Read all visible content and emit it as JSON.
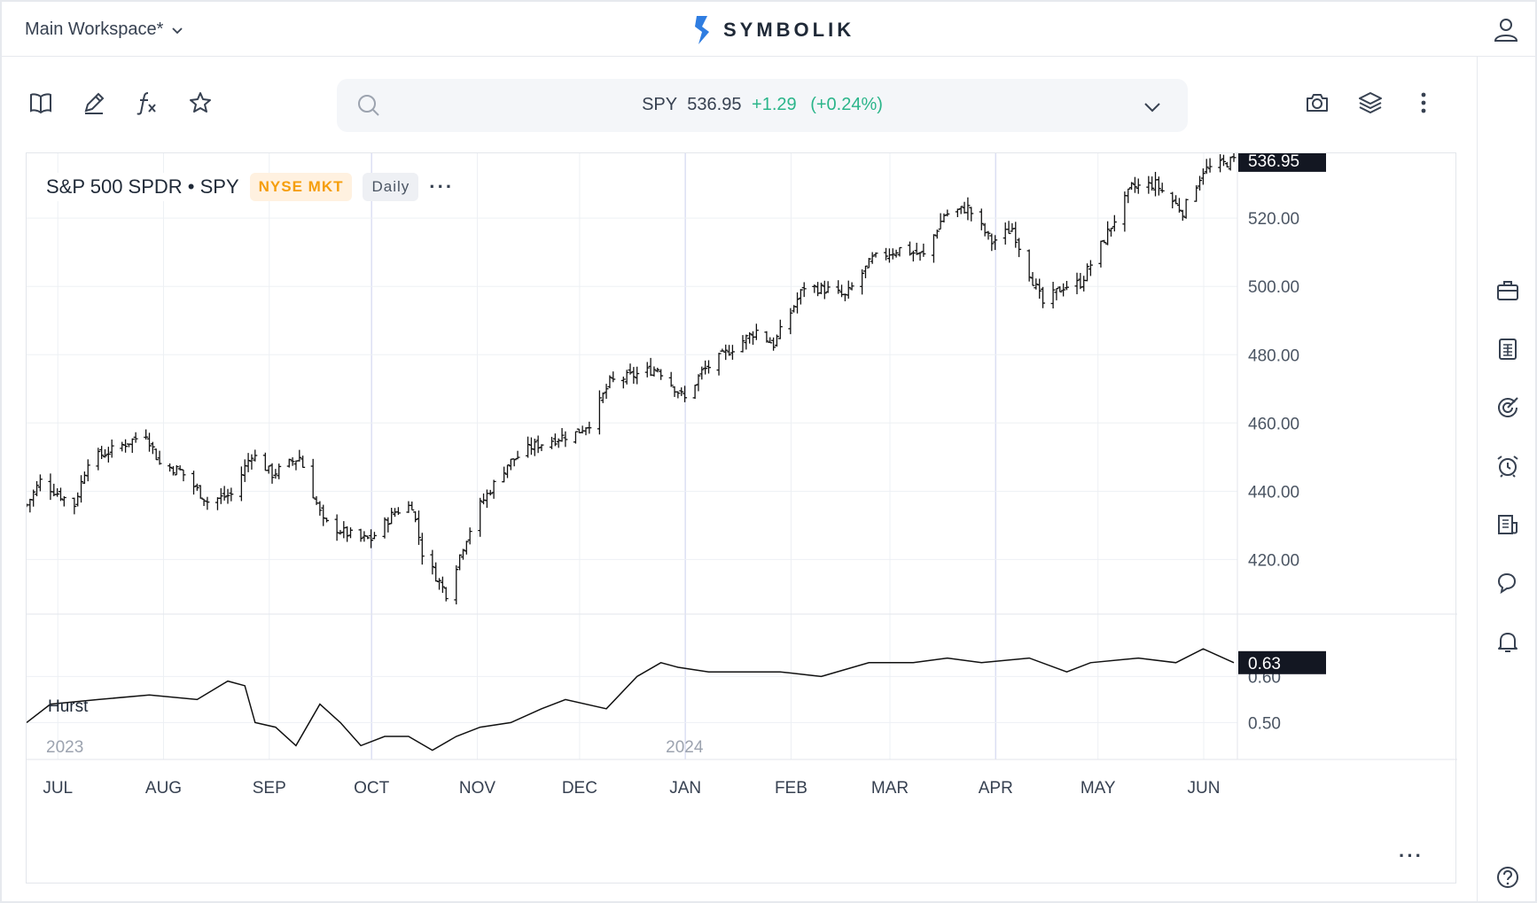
{
  "workspace": {
    "label": "Main Workspace*"
  },
  "brand": {
    "name": "SYMBOLIK"
  },
  "quote": {
    "symbol": "SPY",
    "price": "536.95",
    "change": "+1.29",
    "change_pct": "(+0.24%)"
  },
  "legend": {
    "title": "S&P 500 SPDR • SPY",
    "exchange": "NYSE MKT",
    "interval": "Daily",
    "more": "···"
  },
  "indicator": {
    "name": "Hurst"
  },
  "axis_more": "···",
  "colors": {
    "up": "#2bb58a",
    "exchange": "#f59e0b",
    "price_tag_bg": "#131722",
    "grid": "#edf0f4"
  },
  "toolbar": {
    "left_icons": [
      "book-icon",
      "pencil-icon",
      "function-icon",
      "star-icon"
    ],
    "right_icons": [
      "camera-icon",
      "layers-icon",
      "more-vertical-icon"
    ]
  },
  "rail": {
    "icons": [
      "briefcase-icon",
      "calculator-icon",
      "target-icon",
      "alarm-clock-icon",
      "report-icon",
      "chat-icon",
      "bell-icon",
      "help-icon"
    ]
  },
  "chart_data": [
    {
      "type": "ohlc",
      "title": "S&P 500 SPDR • SPY",
      "interval": "Daily",
      "ylim": [
        404,
        539
      ],
      "y_ticks": [
        "420.00",
        "440.00",
        "460.00",
        "480.00",
        "500.00",
        "520.00"
      ],
      "last_price_tag": "536.95",
      "x_ticks": [
        "JUL",
        "AUG",
        "SEP",
        "OCT",
        "NOV",
        "DEC",
        "JAN",
        "FEB",
        "MAR",
        "APR",
        "MAY",
        "JUN"
      ],
      "year_labels": [
        "2023",
        "2024"
      ],
      "x_range": [
        "2023-06-26",
        "2024-06-14"
      ],
      "close_series": [
        [
          "2023-06-26",
          436
        ],
        [
          "2023-06-30",
          443
        ],
        [
          "2023-07-07",
          438
        ],
        [
          "2023-07-10",
          436
        ],
        [
          "2023-07-14",
          449
        ],
        [
          "2023-07-21",
          452
        ],
        [
          "2023-07-31",
          457
        ],
        [
          "2023-08-04",
          448
        ],
        [
          "2023-08-10",
          446
        ],
        [
          "2023-08-18",
          437
        ],
        [
          "2023-08-25",
          439
        ],
        [
          "2023-08-31",
          451
        ],
        [
          "2023-09-06",
          445
        ],
        [
          "2023-09-14",
          450
        ],
        [
          "2023-09-21",
          431
        ],
        [
          "2023-09-27",
          428
        ],
        [
          "2023-10-02",
          426
        ],
        [
          "2023-10-05",
          426
        ],
        [
          "2023-10-12",
          434
        ],
        [
          "2023-10-17",
          436
        ],
        [
          "2023-10-20",
          422
        ],
        [
          "2023-10-27",
          410
        ],
        [
          "2023-11-01",
          424
        ],
        [
          "2023-11-06",
          436
        ],
        [
          "2023-11-14",
          448
        ],
        [
          "2023-11-21",
          453
        ],
        [
          "2023-11-30",
          456
        ],
        [
          "2023-12-04",
          457
        ],
        [
          "2023-12-08",
          460
        ],
        [
          "2023-12-14",
          472
        ],
        [
          "2023-12-28",
          476
        ],
        [
          "2024-01-05",
          467
        ],
        [
          "2024-01-10",
          475
        ],
        [
          "2024-01-19",
          482
        ],
        [
          "2024-01-26",
          487
        ],
        [
          "2024-01-31",
          483
        ],
        [
          "2024-02-09",
          500
        ],
        [
          "2024-02-16",
          499
        ],
        [
          "2024-02-21",
          497
        ],
        [
          "2024-02-29",
          508
        ],
        [
          "2024-03-08",
          511
        ],
        [
          "2024-03-15",
          509
        ],
        [
          "2024-03-21",
          521
        ],
        [
          "2024-03-28",
          523
        ],
        [
          "2024-04-04",
          513
        ],
        [
          "2024-04-10",
          517
        ],
        [
          "2024-04-15",
          504
        ],
        [
          "2024-04-19",
          495
        ],
        [
          "2024-04-25",
          500
        ],
        [
          "2024-04-30",
          501
        ],
        [
          "2024-05-06",
          512
        ],
        [
          "2024-05-15",
          529
        ],
        [
          "2024-05-22",
          530
        ],
        [
          "2024-05-30",
          522
        ],
        [
          "2024-06-05",
          534
        ],
        [
          "2024-06-14",
          536.95
        ]
      ]
    },
    {
      "type": "line",
      "name": "Hurst",
      "ylim": [
        0.42,
        0.72
      ],
      "y_ticks": [
        "0.50",
        "0.60"
      ],
      "last_value_tag": "0.63",
      "series": [
        [
          "2023-06-26",
          0.5
        ],
        [
          "2023-07-03",
          0.54
        ],
        [
          "2023-07-17",
          0.55
        ],
        [
          "2023-08-01",
          0.56
        ],
        [
          "2023-08-15",
          0.55
        ],
        [
          "2023-08-24",
          0.59
        ],
        [
          "2023-08-29",
          0.58
        ],
        [
          "2023-09-01",
          0.5
        ],
        [
          "2023-09-07",
          0.49
        ],
        [
          "2023-09-13",
          0.45
        ],
        [
          "2023-09-20",
          0.54
        ],
        [
          "2023-09-26",
          0.5
        ],
        [
          "2023-10-02",
          0.45
        ],
        [
          "2023-10-09",
          0.47
        ],
        [
          "2023-10-16",
          0.47
        ],
        [
          "2023-10-23",
          0.44
        ],
        [
          "2023-10-30",
          0.47
        ],
        [
          "2023-11-06",
          0.49
        ],
        [
          "2023-11-15",
          0.5
        ],
        [
          "2023-11-24",
          0.53
        ],
        [
          "2023-12-01",
          0.55
        ],
        [
          "2023-12-13",
          0.53
        ],
        [
          "2023-12-22",
          0.6
        ],
        [
          "2023-12-29",
          0.63
        ],
        [
          "2024-01-03",
          0.62
        ],
        [
          "2024-01-12",
          0.61
        ],
        [
          "2024-01-22",
          0.61
        ],
        [
          "2024-02-02",
          0.61
        ],
        [
          "2024-02-14",
          0.6
        ],
        [
          "2024-02-28",
          0.63
        ],
        [
          "2024-03-12",
          0.63
        ],
        [
          "2024-03-22",
          0.64
        ],
        [
          "2024-04-01",
          0.63
        ],
        [
          "2024-04-15",
          0.64
        ],
        [
          "2024-04-26",
          0.61
        ],
        [
          "2024-05-03",
          0.63
        ],
        [
          "2024-05-17",
          0.64
        ],
        [
          "2024-05-28",
          0.63
        ],
        [
          "2024-06-05",
          0.66
        ],
        [
          "2024-06-14",
          0.63
        ]
      ]
    }
  ]
}
